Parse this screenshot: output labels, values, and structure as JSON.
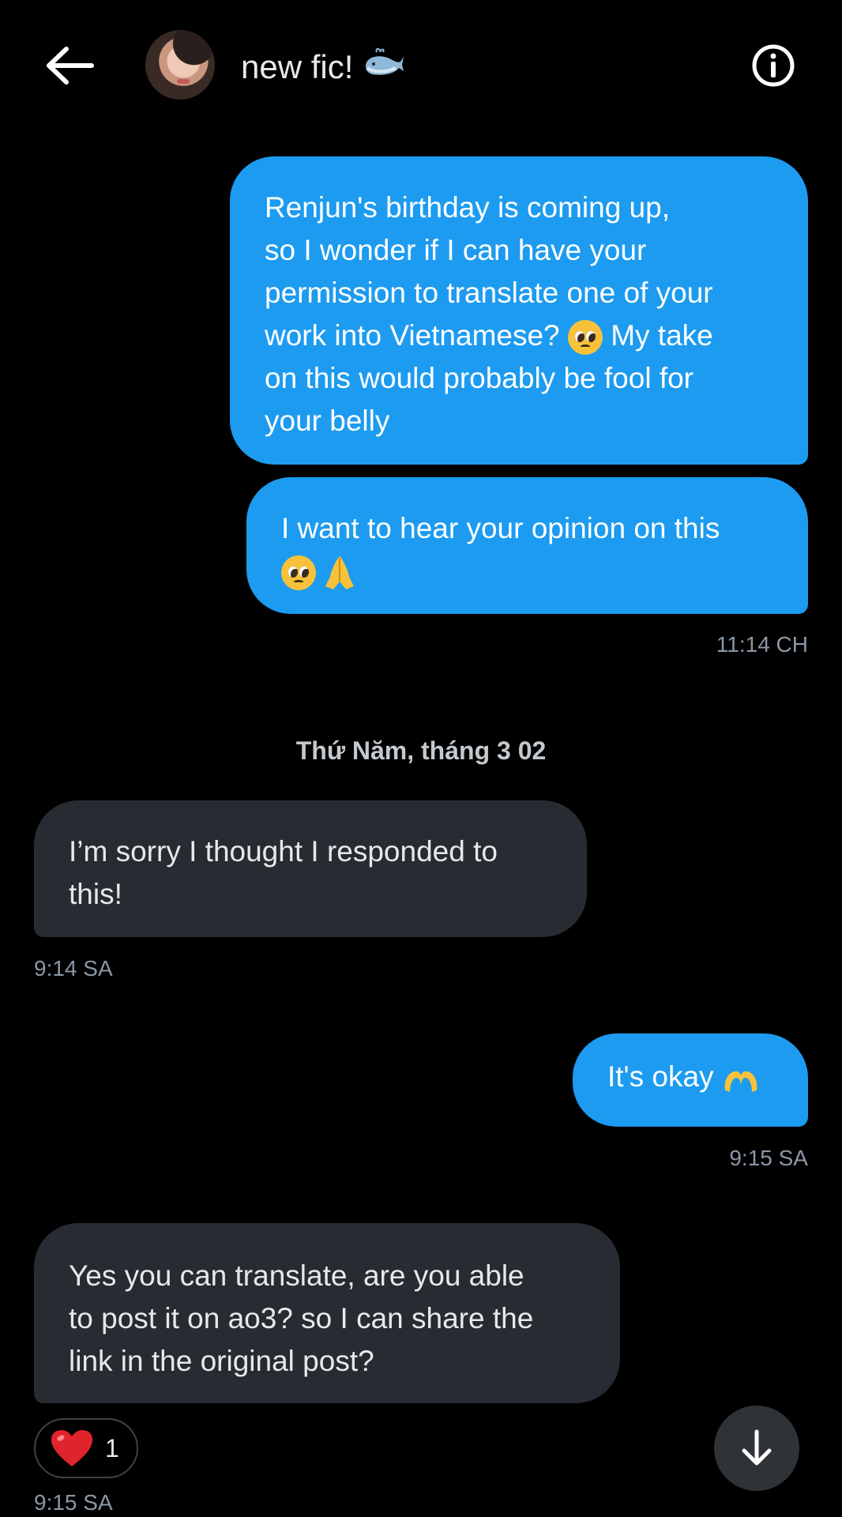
{
  "header": {
    "title": "new fic!",
    "title_emoji": "whale-icon"
  },
  "messages": [
    {
      "direction": "outgoing",
      "lines": [
        "Renjun's birthday is coming up,",
        "so I wonder if I can have your",
        "permission to translate one of your",
        "work into Vietnamese?",
        "My take",
        "on this would probably be fool for",
        "your belly"
      ]
    },
    {
      "direction": "outgoing",
      "lines": [
        "I want to hear your opinion on this"
      ],
      "time": "11:14 CH"
    },
    {
      "direction": "incoming",
      "lines": [
        "I’m sorry I thought I responded to",
        "this!"
      ],
      "time": "9:14 SA"
    },
    {
      "direction": "outgoing",
      "lines": [
        "It's okay"
      ],
      "time": "9:15 SA"
    },
    {
      "direction": "incoming",
      "lines": [
        "Yes you can translate, are you able",
        "to post it on ao3? so I can share the",
        "link in the original post?"
      ],
      "time": "9:15 SA",
      "reaction": {
        "emoji": "heart-icon",
        "count": "1"
      }
    }
  ],
  "date_separator": "Thứ Năm, tháng 3 02",
  "colors": {
    "outgoing_bubble": "#1d9bf0",
    "incoming_bubble": "#272c33",
    "background": "#000000",
    "timestamp": "#8b98a5"
  }
}
